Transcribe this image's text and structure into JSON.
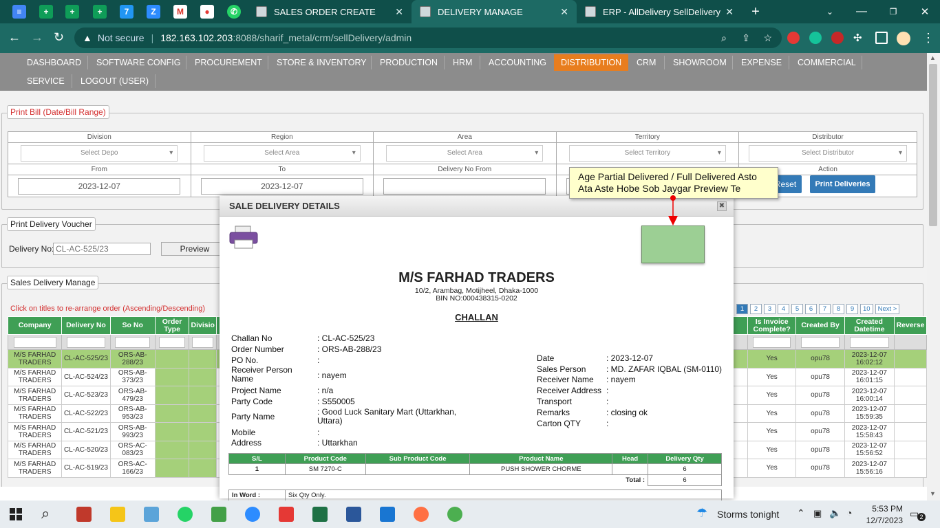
{
  "browser": {
    "tabs": [
      {
        "label": "SALES ORDER CREATE",
        "active": false
      },
      {
        "label": "DELIVERY MANAGE",
        "active": true
      },
      {
        "label": "ERP - AllDelivery SellDelivery",
        "active": false
      }
    ],
    "security": "Not secure",
    "url_host": "182.163.102.203",
    "url_rest": ":8088/sharif_metal/crm/sellDelivery/admin"
  },
  "menu": {
    "row1": [
      "DASHBOARD",
      "SOFTWARE CONFIG",
      "PROCUREMENT",
      "STORE & INVENTORY",
      "PRODUCTION",
      "HRM",
      "ACCOUNTING",
      "DISTRIBUTION",
      "CRM",
      "SHOWROOM",
      "EXPENSE",
      "COMMERCIAL"
    ],
    "row2": [
      "SERVICE",
      "LOGOUT (USER)"
    ],
    "active": "DISTRIBUTION"
  },
  "print_bill": {
    "legend": "Print Bill (Date/Bill Range)",
    "h1": [
      "Division",
      "Region",
      "Area",
      "Territory",
      "Distributor"
    ],
    "selects": [
      "Select Depo",
      "Select Area",
      "Select Area",
      "Select Territory",
      "Select Distributor"
    ],
    "h2": [
      "From",
      "To",
      "Delivery No From",
      "",
      "Action"
    ],
    "from": "2023-12-07",
    "to": "2023-12-07",
    "reset": "Reset",
    "print_deliveries": "Print Deliveries"
  },
  "voucher": {
    "legend": "Print Delivery Voucher",
    "label": "Delivery No:",
    "placeholder": "CL-AC-525/23",
    "preview": "Preview"
  },
  "manage": {
    "legend": "Sales Delivery Manage",
    "hint": "Click on titles to re-arrange order (Ascending/Descending)",
    "pages": [
      "1",
      "2",
      "3",
      "4",
      "5",
      "6",
      "7",
      "8",
      "9",
      "10",
      "Next >"
    ],
    "left_headers": [
      "Company",
      "Delivery No",
      "So No",
      "Order Type",
      "Divisio"
    ],
    "right_headers": [
      "Is Invoice Complete?",
      "Created By",
      "Created Datetime",
      "Reverse"
    ],
    "rows": [
      {
        "company": "M/S FARHAD TRADERS",
        "delivery": "CL-AC-525/23",
        "so": "ORS-AB-288/23",
        "invoice": "Yes",
        "by": "opu78",
        "dt": "2023-12-07 16:02:12"
      },
      {
        "company": "M/S FARHAD TRADERS",
        "delivery": "CL-AC-524/23",
        "so": "ORS-AB-373/23",
        "invoice": "Yes",
        "by": "opu78",
        "dt": "2023-12-07 16:01:15"
      },
      {
        "company": "M/S FARHAD TRADERS",
        "delivery": "CL-AC-523/23",
        "so": "ORS-AB-479/23",
        "invoice": "Yes",
        "by": "opu78",
        "dt": "2023-12-07 16:00:14"
      },
      {
        "company": "M/S FARHAD TRADERS",
        "delivery": "CL-AC-522/23",
        "so": "ORS-AB-953/23",
        "invoice": "Yes",
        "by": "opu78",
        "dt": "2023-12-07 15:59:35"
      },
      {
        "company": "M/S FARHAD TRADERS",
        "delivery": "CL-AC-521/23",
        "so": "ORS-AB-993/23",
        "invoice": "Yes",
        "by": "opu78",
        "dt": "2023-12-07 15:58:43"
      },
      {
        "company": "M/S FARHAD TRADERS",
        "delivery": "CL-AC-520/23",
        "so": "ORS-AC-083/23",
        "invoice": "Yes",
        "by": "opu78",
        "dt": "2023-12-07 15:56:52"
      },
      {
        "company": "M/S FARHAD TRADERS",
        "delivery": "CL-AC-519/23",
        "so": "ORS-AC-166/23",
        "invoice": "Yes",
        "by": "opu78",
        "dt": "2023-12-07 15:56:16"
      }
    ]
  },
  "modal": {
    "title": "SALE DELIVERY DETAILS",
    "company": "M/S FARHAD TRADERS",
    "address": "10/2, Arambag, Motijheel, Dhaka-1000",
    "bin": "BIN NO:000438315-0202",
    "doc_title": "CHALLAN",
    "left": [
      {
        "k": "Challan No",
        "v": ": CL-AC-525/23"
      },
      {
        "k": "Order Number",
        "v": ": ORS-AB-288/23"
      },
      {
        "k": "PO No.",
        "v": ":"
      },
      {
        "k": "Receiver Person Name",
        "v": ": nayem"
      },
      {
        "k": "Project Name",
        "v": ": n/a"
      },
      {
        "k": "Party Code",
        "v": ": S550005"
      },
      {
        "k": "Party Name",
        "v": ": Good Luck Sanitary Mart (Uttarkhan, Uttara)"
      },
      {
        "k": "Mobile",
        "v": ":"
      },
      {
        "k": "Address",
        "v": ": Uttarkhan"
      }
    ],
    "right": [
      {
        "k": "Date",
        "v": ": 2023-12-07"
      },
      {
        "k": "Sales Person",
        "v": ": MD. ZAFAR IQBAL (SM-0110)"
      },
      {
        "k": "Receiver Name",
        "v": ": nayem"
      },
      {
        "k": "Receiver Address",
        "v": ":"
      },
      {
        "k": "Transport",
        "v": ":"
      },
      {
        "k": "Remarks",
        "v": ": closing ok"
      },
      {
        "k": "Carton QTY",
        "v": ":"
      }
    ],
    "product_headers": [
      "S/L",
      "Product Code",
      "Sub Product Code",
      "Product Name",
      "Head",
      "Delivery Qty"
    ],
    "products": [
      {
        "sl": "1",
        "code": "SM 7270-C",
        "sub": "",
        "name": "PUSH SHOWER CHORME",
        "head": "",
        "qty": "6"
      }
    ],
    "total_label": "Total :",
    "total": "6",
    "inword_label": "In Word :",
    "inword": "Six Qty Only."
  },
  "tooltip": "Age Partial Delivered / Full Delivered Asto Ata Aste Hobe Sob Jaygar Preview Te",
  "taskbar": {
    "weather": "Storms tonight",
    "time": "5:53 PM",
    "date": "12/7/2023",
    "notif": "2"
  },
  "colors": {
    "accent_green": "#3f9f55",
    "menu_active": "#e87d1e",
    "browser": "#1d6a64",
    "highlight_row": "#a5d07a"
  }
}
